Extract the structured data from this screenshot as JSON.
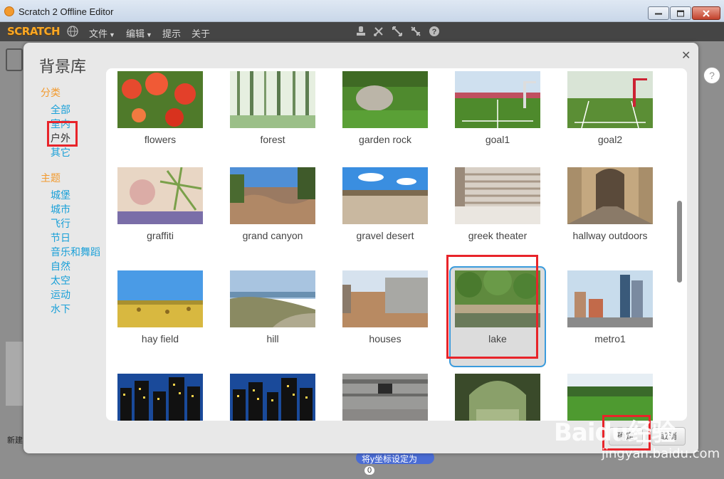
{
  "window": {
    "title": "Scratch 2 Offline Editor"
  },
  "menubar": {
    "logo": "SCRATCH",
    "items": [
      {
        "label": "文件"
      },
      {
        "label": "编辑"
      },
      {
        "label": "提示"
      },
      {
        "label": "关于"
      }
    ]
  },
  "dialog": {
    "title": "背景库",
    "category_heading": "分类",
    "categories": [
      {
        "label": "全部"
      },
      {
        "label": "室内"
      },
      {
        "label": "户外"
      },
      {
        "label": "其它"
      }
    ],
    "theme_heading": "主题",
    "themes": [
      {
        "label": "城堡"
      },
      {
        "label": "城市"
      },
      {
        "label": "飞行"
      },
      {
        "label": "节日"
      },
      {
        "label": "音乐和舞蹈"
      },
      {
        "label": "自然"
      },
      {
        "label": "太空"
      },
      {
        "label": "运动"
      },
      {
        "label": "水下"
      }
    ],
    "backdrops": [
      {
        "label": "flowers"
      },
      {
        "label": "forest"
      },
      {
        "label": "garden rock"
      },
      {
        "label": "goal1"
      },
      {
        "label": "goal2"
      },
      {
        "label": "graffiti"
      },
      {
        "label": "grand canyon"
      },
      {
        "label": "gravel desert"
      },
      {
        "label": "greek theater"
      },
      {
        "label": "hallway outdoors"
      },
      {
        "label": "hay field"
      },
      {
        "label": "hill"
      },
      {
        "label": "houses"
      },
      {
        "label": "lake"
      },
      {
        "label": "metro1"
      },
      {
        "label": ""
      },
      {
        "label": ""
      },
      {
        "label": ""
      },
      {
        "label": ""
      },
      {
        "label": ""
      }
    ],
    "selected": "lake",
    "ok_label": "确定",
    "cancel_label": "取消"
  },
  "editor": {
    "block_text": "将y坐标设定为",
    "block_value": "0",
    "new_label": "新建"
  },
  "watermark": {
    "brand": "Baidu经验",
    "url": "jingyan.baidu.com"
  },
  "colors": {
    "category_heading": "#f29a2e",
    "link": "#1aa0d8",
    "selection": "#3a9bdc",
    "annotation": "#e8242a"
  }
}
